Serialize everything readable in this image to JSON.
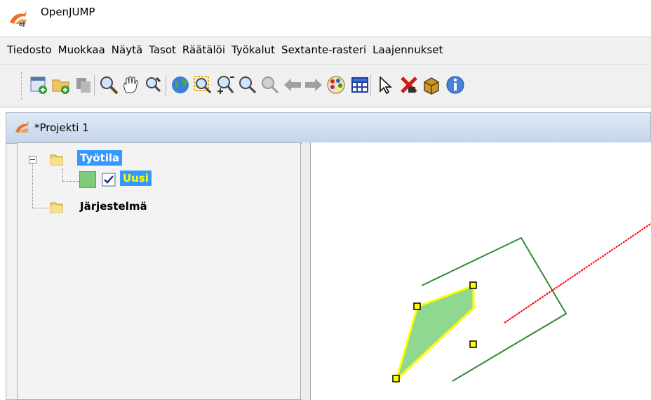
{
  "app": {
    "title": "OpenJUMP"
  },
  "menu": {
    "items": [
      "Tiedosto",
      "Muokkaa",
      "Näytä",
      "Tasot",
      "Räätälöi",
      "Työkalut",
      "Sextante-rasteri",
      "Laajennukset"
    ]
  },
  "toolbar": {
    "icons": [
      "new-project-icon",
      "open-folder-icon",
      "copy-icon",
      "zoom-icon",
      "pan-hand-icon",
      "zoom-to-selection-icon",
      "globe-full-extent-icon",
      "zoom-to-layer-icon",
      "zoom-out-icon",
      "zoom-disabled-icon",
      "previous-view-icon",
      "next-view-icon",
      "palette-icon",
      "grid-table-icon",
      "select-arrow-icon",
      "delete-icon",
      "feature-info-box-icon",
      "info-icon"
    ]
  },
  "project": {
    "title": "*Projekti 1"
  },
  "tree": {
    "category_working": "Työtila",
    "layer_name": "Uusi",
    "layer_checked": true,
    "category_system": "Järjestelmä"
  },
  "colors": {
    "selection_bg": "#3399ff",
    "layer_text": "#ffff00",
    "layer_fill": "#7ccc7c",
    "polygon_fill": "#90d890",
    "polygon_outline": "#ffff00",
    "line_green": "#2e8b2e",
    "line_red": "#ff0000",
    "vertex_handle": "#ffff00"
  }
}
